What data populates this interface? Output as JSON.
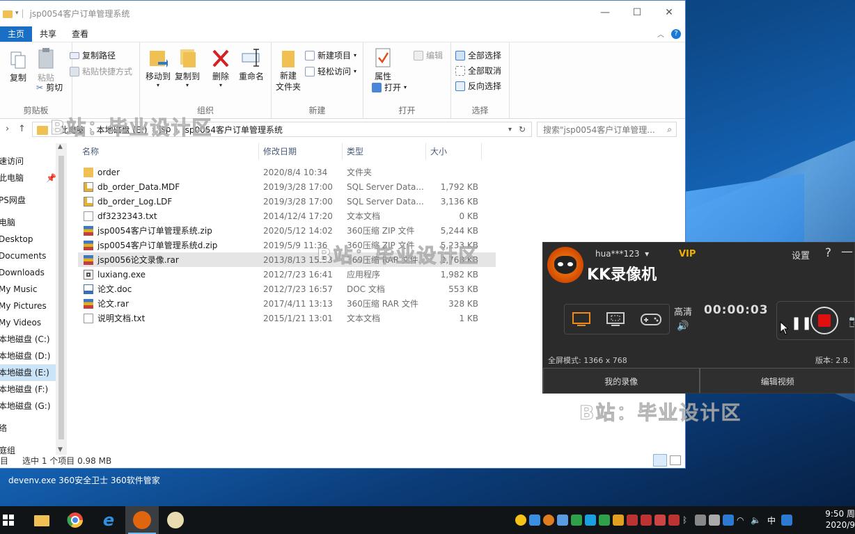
{
  "window": {
    "title": "jsp0054客户订单管理系统",
    "tabs": [
      "主页",
      "共享",
      "查看"
    ],
    "ribbon": {
      "clipboard": {
        "label": "剪贴板",
        "copy": "复制",
        "paste": "粘贴",
        "copy_path": "复制路径",
        "paste_shortcut": "粘贴快捷方式",
        "cut": "剪切"
      },
      "organize": {
        "label": "组织",
        "move_to": "移动到",
        "copy_to": "复制到",
        "delete": "删除",
        "rename": "重命名"
      },
      "new": {
        "label": "新建",
        "new_folder": "新建\n文件夹",
        "new_item": "新建项目",
        "easy_access": "轻松访问"
      },
      "open": {
        "label": "打开",
        "properties": "属性",
        "open": "打开",
        "edit": "编辑"
      },
      "select": {
        "label": "选择",
        "select_all": "全部选择",
        "select_none": "全部取消",
        "invert": "反向选择"
      }
    },
    "address": {
      "parts": [
        "此电脑",
        "本地磁盘 (E:)",
        "jsp",
        "jsp0054客户订单管理系统"
      ]
    },
    "search_placeholder": "搜索\"jsp0054客户订单管理...",
    "nav_items": [
      "速访问",
      "此电脑",
      "PS网盘",
      "电脑",
      "Desktop",
      "Documents",
      "Downloads",
      "My Music",
      "My Pictures",
      "My Videos",
      "本地磁盘 (C:)",
      "本地磁盘 (D:)",
      "本地磁盘 (E:)",
      "本地磁盘 (F:)",
      "本地磁盘 (G:)",
      "络",
      "庭组"
    ],
    "columns": {
      "name": "名称",
      "date": "修改日期",
      "type": "类型",
      "size": "大小"
    },
    "files": [
      {
        "name": "order",
        "date": "2020/8/4 10:34",
        "type": "文件夹",
        "size": "",
        "icon": "folder-icon"
      },
      {
        "name": "db_order_Data.MDF",
        "date": "2019/3/28 17:00",
        "type": "SQL Server Data...",
        "size": "1,792 KB",
        "icon": "database-file-icon"
      },
      {
        "name": "db_order_Log.LDF",
        "date": "2019/3/28 17:00",
        "type": "SQL Server Data...",
        "size": "3,136 KB",
        "icon": "database-file-icon"
      },
      {
        "name": "df3232343.txt",
        "date": "2014/12/4 17:20",
        "type": "文本文档",
        "size": "0 KB",
        "icon": "text-file-icon"
      },
      {
        "name": "jsp0054客户订单管理系统.zip",
        "date": "2020/5/12 14:02",
        "type": "360压缩 ZIP 文件",
        "size": "5,244 KB",
        "icon": "archive-icon"
      },
      {
        "name": "jsp0054客户订单管理系统d.zip",
        "date": "2019/5/9 11:36",
        "type": "360压缩 ZIP 文件",
        "size": "5,233 KB",
        "icon": "archive-icon"
      },
      {
        "name": "jsp0056论文录像.rar",
        "date": "2013/8/13 15:53",
        "type": "360压缩 RAR 文件",
        "size": "2,768 KB",
        "icon": "archive-icon"
      },
      {
        "name": "luxiang.exe",
        "date": "2012/7/23 16:41",
        "type": "应用程序",
        "size": "1,982 KB",
        "icon": "exe-icon"
      },
      {
        "name": "论文.doc",
        "date": "2012/7/23 16:57",
        "type": "DOC 文档",
        "size": "553 KB",
        "icon": "doc-icon"
      },
      {
        "name": "论文.rar",
        "date": "2017/4/11 13:13",
        "type": "360压缩 RAR 文件",
        "size": "328 KB",
        "icon": "archive-icon"
      },
      {
        "name": "说明文档.txt",
        "date": "2015/1/21 13:01",
        "type": "文本文档",
        "size": "1 KB",
        "icon": "text-file-icon"
      }
    ],
    "status": {
      "count": "目",
      "selected": "选中 1 个项目  0.98 MB"
    }
  },
  "watermark": "B站：毕业设计区",
  "recorder": {
    "user": "hua***123",
    "vip": "VIP",
    "title": "KK录像机",
    "settings": "设置",
    "quality": "高清",
    "time": "00:00:03",
    "mode": "全屏模式: 1366 x 768",
    "version": "版本: 2.8.",
    "my_recordings": "我的录像",
    "edit_video": "编辑视频"
  },
  "desktop_label": "devenv.exe  360安全卫士  360软件管家",
  "clock": {
    "time": "9:50 周",
    "date": "2020/9"
  },
  "tray_ime": "中"
}
